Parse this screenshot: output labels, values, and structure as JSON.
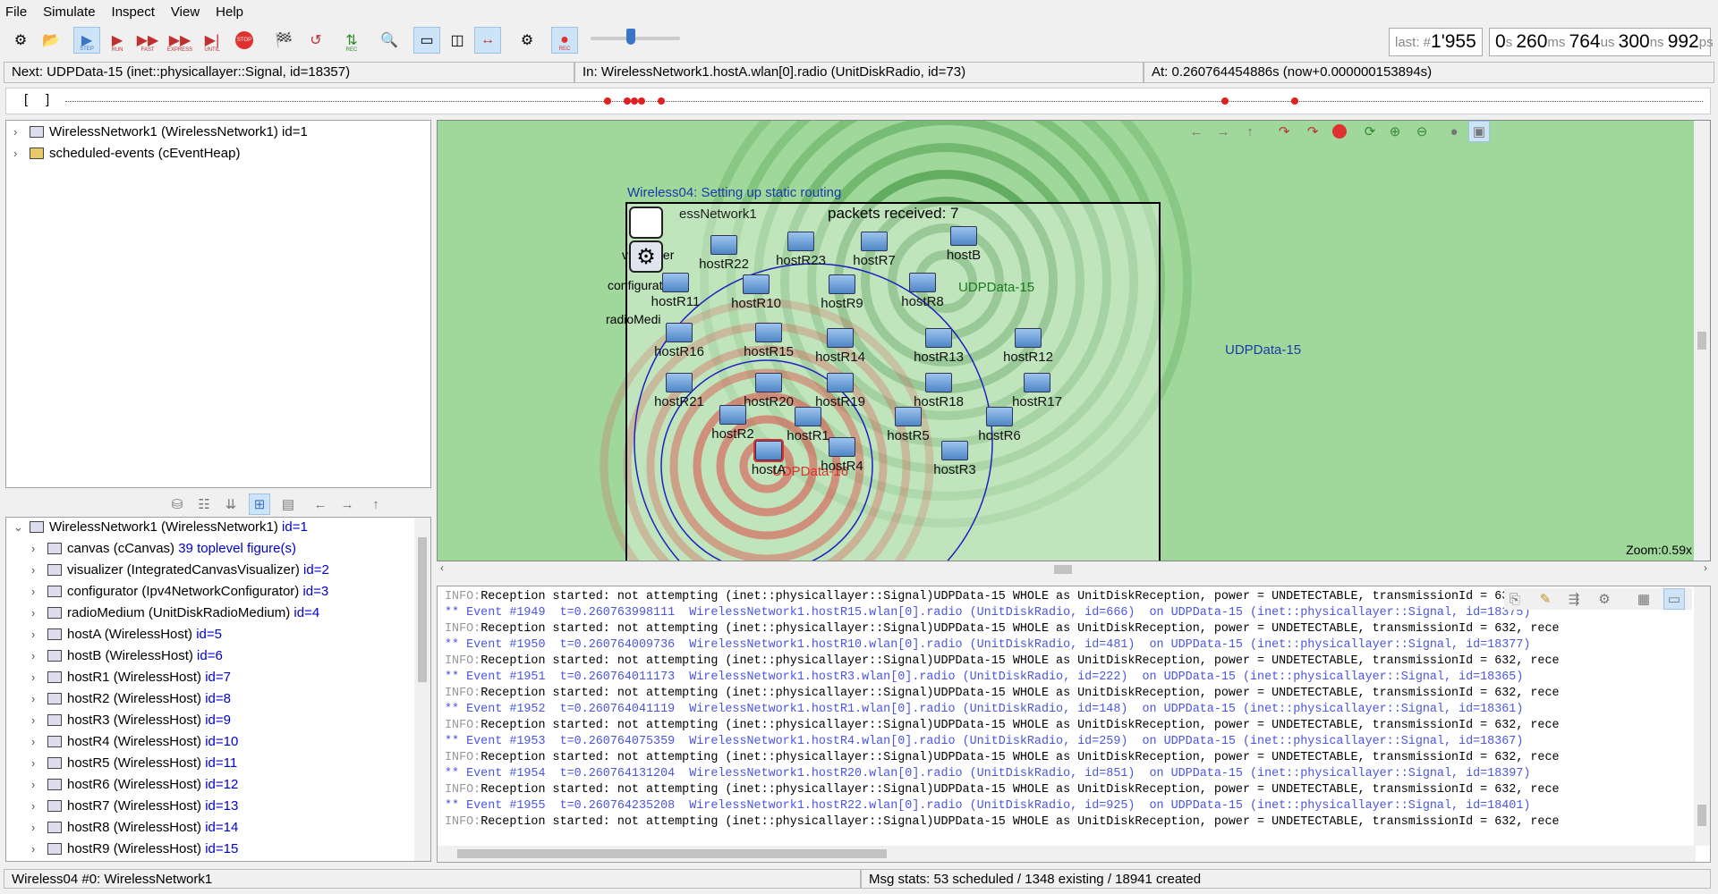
{
  "menu": [
    "File",
    "Simulate",
    "Inspect",
    "View",
    "Help"
  ],
  "toolbar": {
    "step": "STEP",
    "run": "RUN",
    "fast": "FAST",
    "express": "EXPRESS",
    "until": "UNTIL",
    "stop": "STOP",
    "rec": "REC",
    "rec2": "REC"
  },
  "event_counter": {
    "label": "last: #",
    "value": "1'955"
  },
  "sim_time": {
    "s_val": "0",
    "s_unit": "s",
    "ms_val": "260",
    "ms_unit": "ms",
    "us_val": "764",
    "us_unit": "us",
    "ns_val": "300",
    "ns_unit": "ns",
    "ps_val": "992",
    "ps_unit": "ps"
  },
  "info": {
    "next": "Next: UDPData-15 (inet::physicallayer::Signal, id=18357)",
    "in": "In: WirelessNetwork1.hostA.wlan[0].radio (UnitDiskRadio, id=73)",
    "at": "At: 0.260764454886s (now+0.000000153894s)"
  },
  "timeline": {
    "open_bracket": "[",
    "close_bracket": "]"
  },
  "object_tree": [
    {
      "label": "WirelessNetwork1 (WirelessNetwork1) id=1"
    },
    {
      "label": "scheduled-events (cEventHeap)"
    }
  ],
  "module_tree": {
    "root": {
      "name": "WirelessNetwork1 (WirelessNetwork1)",
      "id": "id=1"
    },
    "children": [
      {
        "name": "canvas (cCanvas)",
        "id": "39 toplevel figure(s)"
      },
      {
        "name": "visualizer (IntegratedCanvasVisualizer)",
        "id": "id=2"
      },
      {
        "name": "configurator (Ipv4NetworkConfigurator)",
        "id": "id=3"
      },
      {
        "name": "radioMedium (UnitDiskRadioMedium)",
        "id": "id=4"
      },
      {
        "name": "hostA (WirelessHost)",
        "id": "id=5"
      },
      {
        "name": "hostB (WirelessHost)",
        "id": "id=6"
      },
      {
        "name": "hostR1 (WirelessHost)",
        "id": "id=7"
      },
      {
        "name": "hostR2 (WirelessHost)",
        "id": "id=8"
      },
      {
        "name": "hostR3 (WirelessHost)",
        "id": "id=9"
      },
      {
        "name": "hostR4 (WirelessHost)",
        "id": "id=10"
      },
      {
        "name": "hostR5 (WirelessHost)",
        "id": "id=11"
      },
      {
        "name": "hostR6 (WirelessHost)",
        "id": "id=12"
      },
      {
        "name": "hostR7 (WirelessHost)",
        "id": "id=13"
      },
      {
        "name": "hostR8 (WirelessHost)",
        "id": "id=14"
      },
      {
        "name": "hostR9 (WirelessHost)",
        "id": "id=15"
      }
    ]
  },
  "canvas": {
    "title": "Wireless04: Setting up static routing",
    "network_label": "essNetwork1",
    "packets_received": "packets received: 7",
    "visualizer_label": "visualizer",
    "configurator_label": "configurator",
    "radiomedium_label": "radioMedi",
    "signal_green_label": "UDPData-15",
    "signal_red_label": "UDPData-16",
    "outside_label": "UDPData-15",
    "zoom": "Zoom:0.59x",
    "hosts": [
      "hostR22",
      "hostR23",
      "hostR7",
      "hostB",
      "hostR11",
      "hostR10",
      "hostR9",
      "hostR8",
      "hostR16",
      "hostR15",
      "hostR14",
      "hostR13",
      "hostR12",
      "hostR21",
      "hostR20",
      "hostR19",
      "hostR18",
      "hostR17",
      "hostR2",
      "hostR1",
      "hostR5",
      "hostR6",
      "hostA",
      "hostR4",
      "hostR3"
    ]
  },
  "log": [
    {
      "t": "info",
      "lvl": "INFO:",
      "text": "Reception started: not attempting (inet::physicallayer::Signal)UDPData-15 WHOLE as UnitDiskReception, power = UNDETECTABLE, transmissionId = 632, rece"
    },
    {
      "t": "ev",
      "text": "** Event #1949  t=0.260763998111  WirelessNetwork1.hostR15.wlan[0].radio (UnitDiskRadio, id=666)  on UDPData-15 (inet::physicallayer::Signal, id=18375)"
    },
    {
      "t": "info",
      "lvl": "INFO:",
      "text": "Reception started: not attempting (inet::physicallayer::Signal)UDPData-15 WHOLE as UnitDiskReception, power = UNDETECTABLE, transmissionId = 632, rece"
    },
    {
      "t": "ev",
      "text": "** Event #1950  t=0.260764009736  WirelessNetwork1.hostR10.wlan[0].radio (UnitDiskRadio, id=481)  on UDPData-15 (inet::physicallayer::Signal, id=18377)"
    },
    {
      "t": "info",
      "lvl": "INFO:",
      "text": "Reception started: not attempting (inet::physicallayer::Signal)UDPData-15 WHOLE as UnitDiskReception, power = UNDETECTABLE, transmissionId = 632, rece"
    },
    {
      "t": "ev",
      "text": "** Event #1951  t=0.260764011173  WirelessNetwork1.hostR3.wlan[0].radio (UnitDiskRadio, id=222)  on UDPData-15 (inet::physicallayer::Signal, id=18365)"
    },
    {
      "t": "info",
      "lvl": "INFO:",
      "text": "Reception started: not attempting (inet::physicallayer::Signal)UDPData-15 WHOLE as UnitDiskReception, power = UNDETECTABLE, transmissionId = 632, rece"
    },
    {
      "t": "ev",
      "text": "** Event #1952  t=0.260764041119  WirelessNetwork1.hostR1.wlan[0].radio (UnitDiskRadio, id=148)  on UDPData-15 (inet::physicallayer::Signal, id=18361)"
    },
    {
      "t": "info",
      "lvl": "INFO:",
      "text": "Reception started: not attempting (inet::physicallayer::Signal)UDPData-15 WHOLE as UnitDiskReception, power = UNDETECTABLE, transmissionId = 632, rece"
    },
    {
      "t": "ev",
      "text": "** Event #1953  t=0.260764075359  WirelessNetwork1.hostR4.wlan[0].radio (UnitDiskRadio, id=259)  on UDPData-15 (inet::physicallayer::Signal, id=18367)"
    },
    {
      "t": "info",
      "lvl": "INFO:",
      "text": "Reception started: not attempting (inet::physicallayer::Signal)UDPData-15 WHOLE as UnitDiskReception, power = UNDETECTABLE, transmissionId = 632, rece"
    },
    {
      "t": "ev",
      "text": "** Event #1954  t=0.260764131204  WirelessNetwork1.hostR20.wlan[0].radio (UnitDiskRadio, id=851)  on UDPData-15 (inet::physicallayer::Signal, id=18397)"
    },
    {
      "t": "info",
      "lvl": "INFO:",
      "text": "Reception started: not attempting (inet::physicallayer::Signal)UDPData-15 WHOLE as UnitDiskReception, power = UNDETECTABLE, transmissionId = 632, rece"
    },
    {
      "t": "ev",
      "text": "** Event #1955  t=0.260764235208  WirelessNetwork1.hostR22.wlan[0].radio (UnitDiskRadio, id=925)  on UDPData-15 (inet::physicallayer::Signal, id=18401)"
    },
    {
      "t": "info",
      "lvl": "INFO:",
      "text": "Reception started: not attempting (inet::physicallayer::Signal)UDPData-15 WHOLE as UnitDiskReception, power = UNDETECTABLE, transmissionId = 632, rece"
    }
  ],
  "status": {
    "left": "Wireless04 #0: WirelessNetwork1",
    "right": "Msg stats: 53 scheduled / 1348 existing / 18941 created"
  },
  "colors": {
    "accent": "#3c74c8",
    "stop": "#e03030",
    "signal_green": "#1e7a1e",
    "signal_red": "#d93030",
    "event_blue": "#4a55e0"
  }
}
